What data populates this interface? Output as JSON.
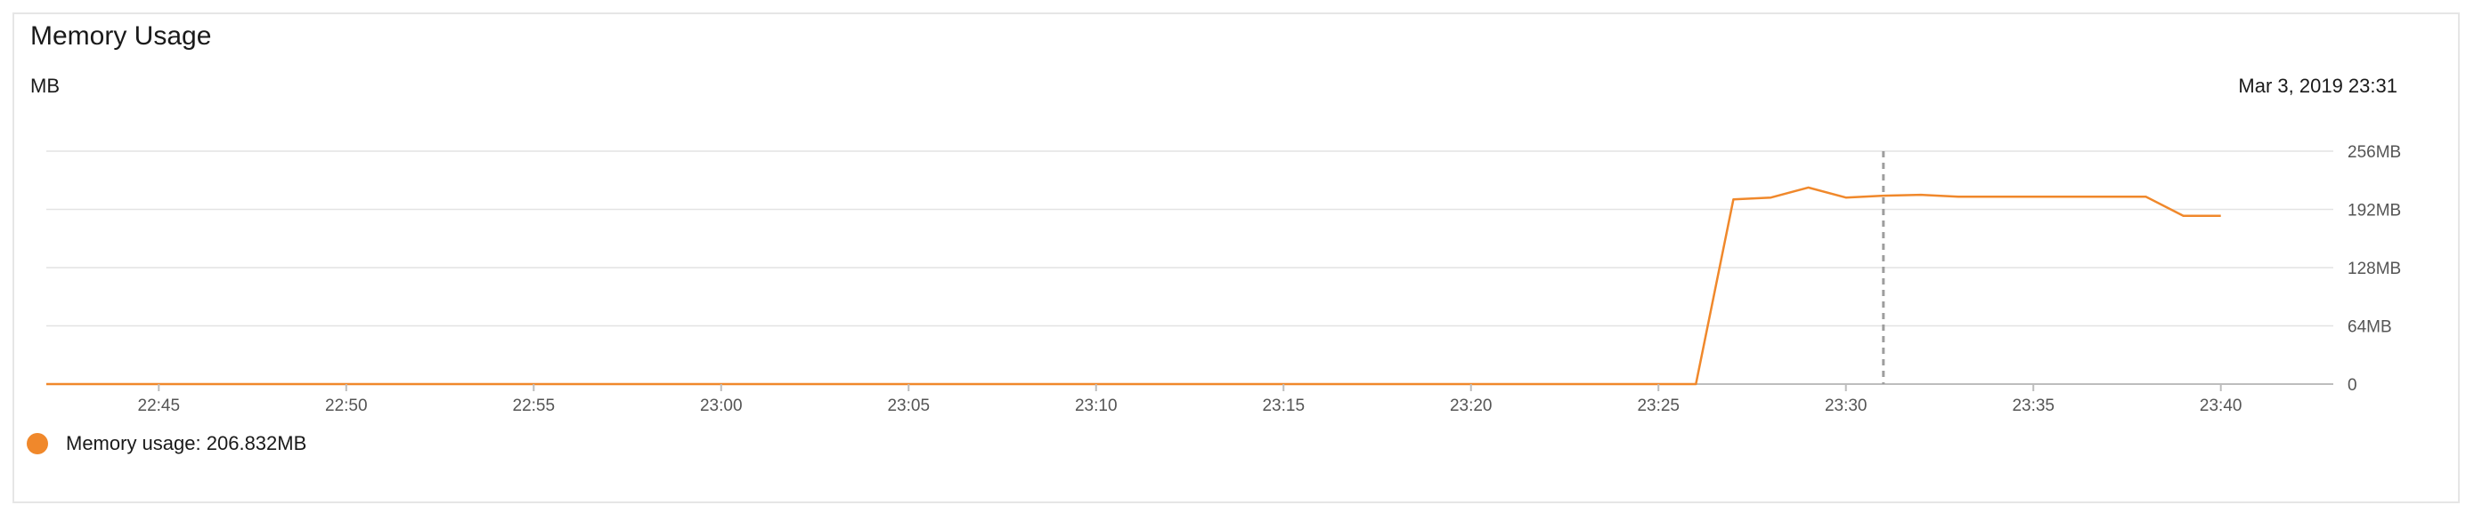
{
  "panel": {
    "title": "Memory Usage",
    "unit": "MB",
    "timestamp": "Mar 3, 2019 23:31"
  },
  "legend": {
    "label": "Memory usage:",
    "value": "206.832MB",
    "color": "#f0882b"
  },
  "chart_data": {
    "type": "line",
    "title": "Memory Usage",
    "ylabel": "MB",
    "xlim": [
      "22:42",
      "23:43"
    ],
    "ylim": [
      0,
      256
    ],
    "y_ticks": [
      0,
      64,
      128,
      256,
      192
    ],
    "y_tick_labels": [
      "0",
      "64MB",
      "128MB",
      "192MB",
      "256MB"
    ],
    "x_ticks": [
      "22:45",
      "22:50",
      "22:55",
      "23:00",
      "23:05",
      "23:10",
      "23:15",
      "23:20",
      "23:25",
      "23:30",
      "23:35",
      "23:40"
    ],
    "grid": true,
    "y_axis_side": "right",
    "crosshair_x": "23:31",
    "series": [
      {
        "name": "Memory usage",
        "color": "#f0882b",
        "points": [
          {
            "x": "22:42",
            "y": 0
          },
          {
            "x": "23:26",
            "y": 0
          },
          {
            "x": "23:27",
            "y": 203
          },
          {
            "x": "23:28",
            "y": 205
          },
          {
            "x": "23:29",
            "y": 216
          },
          {
            "x": "23:30",
            "y": 205
          },
          {
            "x": "23:31",
            "y": 207
          },
          {
            "x": "23:32",
            "y": 208
          },
          {
            "x": "23:33",
            "y": 206
          },
          {
            "x": "23:38",
            "y": 206
          },
          {
            "x": "23:39",
            "y": 185
          },
          {
            "x": "23:40",
            "y": 185
          }
        ]
      }
    ]
  }
}
